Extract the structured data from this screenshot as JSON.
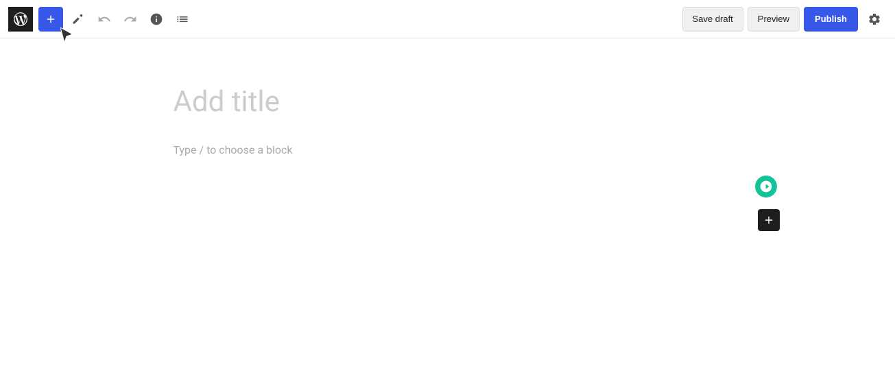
{
  "toolbar": {
    "wp_logo_label": "WordPress",
    "add_block_label": "+",
    "tools_label": "Tools",
    "undo_label": "Undo",
    "redo_label": "Redo",
    "info_label": "Details",
    "list_view_label": "List View",
    "save_draft_label": "Save draft",
    "preview_label": "Preview",
    "publish_label": "Publish",
    "settings_label": "Settings"
  },
  "editor": {
    "title_placeholder": "Add title",
    "block_placeholder": "Type / to choose a block"
  },
  "grammarly": {
    "label": "Grammarly"
  }
}
